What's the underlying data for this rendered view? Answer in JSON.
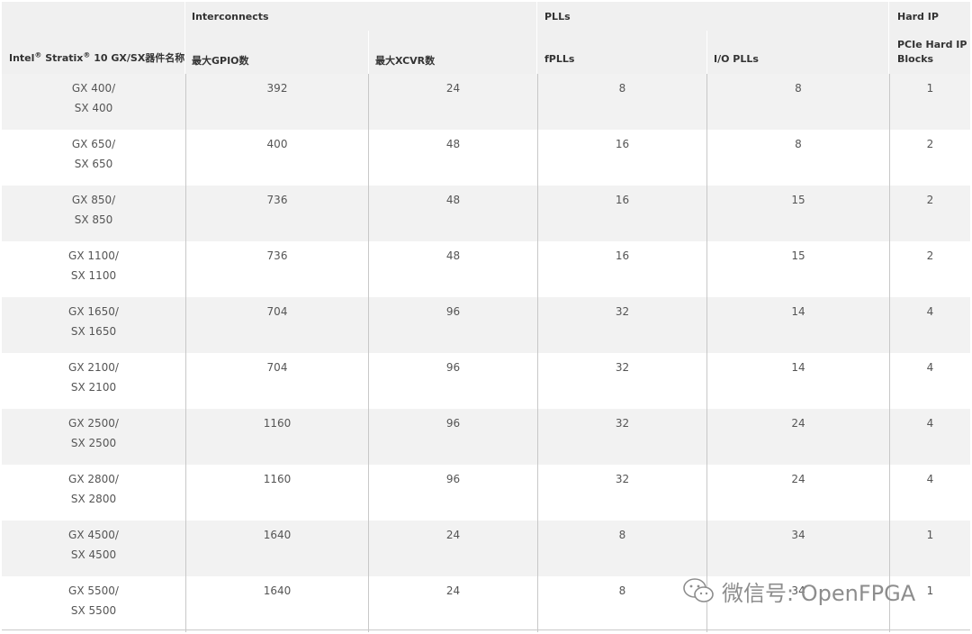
{
  "header": {
    "group_interconnects": "Interconnects",
    "group_plls": "PLLs",
    "group_hardip": "Hard IP",
    "col_name_prefix": "Intel",
    "col_name_reg1": "®",
    "col_name_mid": " Stratix",
    "col_name_reg2": "®",
    "col_name_suffix": " 10 GX/SX器件名称",
    "col_gpio": "最大GPIO数",
    "col_xcvr": "最大XCVR数",
    "col_fplls": "fPLLs",
    "col_iopll": "I/O PLLs",
    "col_pcie_line1": "PCIe Hard IP",
    "col_pcie_line2": "Blocks"
  },
  "rows": [
    {
      "gx": "GX 400/",
      "sx": "SX 400",
      "gpio": "392",
      "xcvr": "24",
      "fpll": "8",
      "iopll": "8",
      "pcie": "1"
    },
    {
      "gx": "GX 650/",
      "sx": "SX 650",
      "gpio": "400",
      "xcvr": "48",
      "fpll": "16",
      "iopll": "8",
      "pcie": "2"
    },
    {
      "gx": "GX 850/",
      "sx": "SX 850",
      "gpio": "736",
      "xcvr": "48",
      "fpll": "16",
      "iopll": "15",
      "pcie": "2"
    },
    {
      "gx": "GX 1100/",
      "sx": "SX 1100",
      "gpio": "736",
      "xcvr": "48",
      "fpll": "16",
      "iopll": "15",
      "pcie": "2"
    },
    {
      "gx": "GX 1650/",
      "sx": "SX 1650",
      "gpio": "704",
      "xcvr": "96",
      "fpll": "32",
      "iopll": "14",
      "pcie": "4"
    },
    {
      "gx": "GX 2100/",
      "sx": "SX 2100",
      "gpio": "704",
      "xcvr": "96",
      "fpll": "32",
      "iopll": "14",
      "pcie": "4"
    },
    {
      "gx": "GX 2500/",
      "sx": "SX 2500",
      "gpio": "1160",
      "xcvr": "96",
      "fpll": "32",
      "iopll": "24",
      "pcie": "4"
    },
    {
      "gx": "GX 2800/",
      "sx": "SX 2800",
      "gpio": "1160",
      "xcvr": "96",
      "fpll": "32",
      "iopll": "24",
      "pcie": "4"
    },
    {
      "gx": "GX 4500/",
      "sx": "SX 4500",
      "gpio": "1640",
      "xcvr": "24",
      "fpll": "8",
      "iopll": "34",
      "pcie": "1"
    },
    {
      "gx": "GX 5500/",
      "sx": "SX 5500",
      "gpio": "1640",
      "xcvr": "24",
      "fpll": "8",
      "iopll": "34",
      "pcie": "1"
    }
  ],
  "watermark": {
    "text": "微信号: OpenFPGA",
    "icon": "wechat-icon",
    "color": "#8d8d8d"
  },
  "colors": {
    "header_bg": "#f0f0f0",
    "row_alt_bg": "#f2f2f2",
    "border": "#c8c8c8"
  }
}
